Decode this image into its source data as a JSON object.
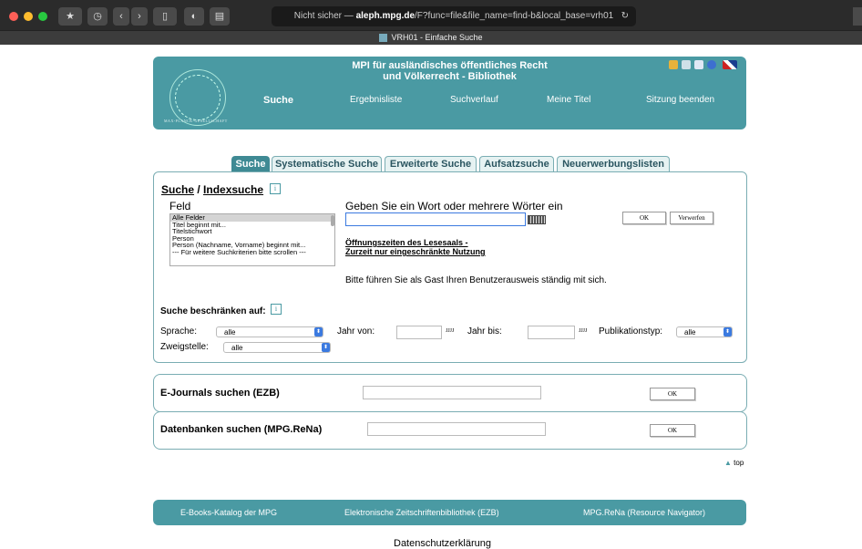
{
  "browser": {
    "url_prefix": "Nicht sicher — ",
    "url_domain": "aleph.mpg.de",
    "url_path": "/F?func=file&file_name=find-b&local_base=vrh01",
    "tab_title": "VRH01 - Einfache Suche"
  },
  "header": {
    "title_line1": "MPI für ausländisches öffentliches Recht",
    "title_line2": "und Völkerrecht - Bibliothek",
    "seal_text": "MAX-PLANCK-GESELLSCHAFT",
    "nav": [
      "Suche",
      "Ergebnisliste",
      "Suchverlauf",
      "Meine Titel",
      "Sitzung beenden"
    ]
  },
  "tabs": [
    "Suche",
    "Systematische Suche",
    "Erweiterte Suche",
    "Aufsatzsuche",
    "Neuerwerbungslisten"
  ],
  "search": {
    "heading_suche": "Suche",
    "heading_sep": " / ",
    "heading_index": "Indexsuche",
    "info_icon": "i",
    "feld_label": "Feld",
    "fields": [
      "Alle Felder",
      "Titel beginnt mit...",
      "Titelstichwort",
      "Person",
      "Person (Nachname, Vorname) beginnt mit...",
      "--- Für weitere Suchkriterien bitte scrollen ---"
    ],
    "prompt": "Geben Sie ein Wort oder mehrere Wörter ein",
    "query_value": "",
    "ok_label": "OK",
    "reset_label": "Verwerfen",
    "notice_line1": "Öffnungszeiten des Lesesaals -",
    "notice_line2": "Zurzeit nur eingeschränkte Nutzung",
    "guest_note": "Bitte führen Sie als Gast Ihren Benutzerausweis ständig mit sich."
  },
  "restrict": {
    "title": "Suche beschränken auf:",
    "sprache_label": "Sprache:",
    "sprache_value": "alle",
    "jahr_von_label": "Jahr von:",
    "jahr_von_value": "",
    "jahr_hint1": "JJJJ",
    "jahr_bis_label": "Jahr bis:",
    "jahr_bis_value": "",
    "jahr_hint2": "JJJJ",
    "pubtyp_label": "Publikationstyp:",
    "pubtyp_value": "alle",
    "zweig_label": "Zweigstelle:",
    "zweig_value": "alle"
  },
  "ejournals": {
    "title": "E-Journals suchen (EZB)",
    "value": "",
    "ok_label": "OK"
  },
  "databases": {
    "title": "Datenbanken suchen (MPG.ReNa)",
    "value": "",
    "ok_label": "OK"
  },
  "top_link": "top",
  "footer": {
    "link1": "E-Books-Katalog der MPG",
    "link2": "Elektronische Zeitschriftenbibliothek (EZB)",
    "link3": "MPG.ReNa (Resource Navigator)"
  },
  "bottom_text": "Datenschutzerklärung",
  "colors": {
    "teal": "#4a9aa3",
    "tab_active": "#3f8a94"
  }
}
